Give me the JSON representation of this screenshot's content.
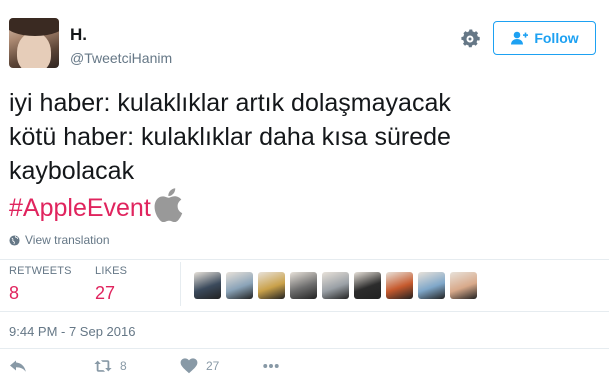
{
  "user": {
    "display_name": "H.",
    "handle": "@TweetciHanim"
  },
  "header": {
    "follow_label": "Follow",
    "settings_icon": "gear-icon",
    "follow_icon": "add-user-icon"
  },
  "tweet": {
    "lines": [
      "iyi haber: kulaklıklar artık dolaşmayacak",
      "kötü haber: kulaklıklar daha kısa sürede",
      "kaybolacak"
    ],
    "hashtag": "#AppleEvent",
    "hashtag_icon": "apple-logo-icon",
    "translation_label": "View translation"
  },
  "stats": {
    "retweets_label": "RETWEETS",
    "retweets_value": "8",
    "likes_label": "LIKES",
    "likes_value": "27"
  },
  "likers": [
    {
      "name": "liker-avatar",
      "color": "#3b4a5c"
    },
    {
      "name": "liker-avatar",
      "color": "#8aa3b8"
    },
    {
      "name": "liker-avatar",
      "color": "#c9a14a"
    },
    {
      "name": "liker-avatar",
      "color": "#6d6d6d"
    },
    {
      "name": "liker-avatar",
      "color": "#9aa0a6"
    },
    {
      "name": "liker-avatar",
      "color": "#2c2c2c"
    },
    {
      "name": "liker-avatar",
      "color": "#c65a2e"
    },
    {
      "name": "liker-avatar",
      "color": "#7fa7c9"
    },
    {
      "name": "liker-avatar",
      "color": "#d8a98a"
    }
  ],
  "timestamp": "9:44 PM - 7 Sep 2016",
  "actions": {
    "reply_icon": "reply-icon",
    "retweet_icon": "retweet-icon",
    "retweet_count": "8",
    "like_icon": "heart-icon",
    "like_count": "27",
    "more_icon": "more-icon"
  },
  "colors": {
    "accent": "#1da1f2",
    "hashtag": "#e0245e",
    "muted": "#657786"
  }
}
